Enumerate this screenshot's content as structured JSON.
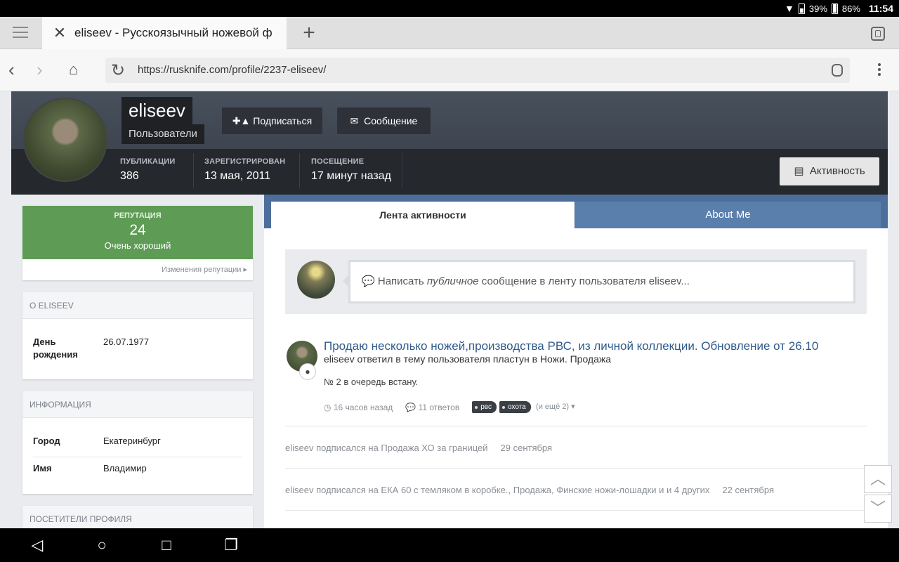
{
  "status_bar": {
    "battery1": "39%",
    "battery2": "86%",
    "time": "11:54"
  },
  "browser": {
    "tab_title": "eliseev - Русскоязычный ножевой ф",
    "url": "https://rusknife.com/profile/2237-eliseev/"
  },
  "profile": {
    "username": "eliseev",
    "group": "Пользователи",
    "follow_label": "Подписаться",
    "message_label": "Сообщение",
    "activity_label": "Активность",
    "stats": [
      {
        "label": "ПУБЛИКАЦИИ",
        "value": "386"
      },
      {
        "label": "ЗАРЕГИСТРИРОВАН",
        "value": "13 мая, 2011"
      },
      {
        "label": "ПОСЕЩЕНИЕ",
        "value": "17 минут назад"
      }
    ]
  },
  "sidebar": {
    "reputation": {
      "label": "РЕПУТАЦИЯ",
      "value": "24",
      "desc": "Очень хороший",
      "link": "Изменения репутации"
    },
    "about": {
      "title": "О ELISEEV",
      "rows": [
        {
          "key": "День рождения",
          "value": "26.07.1977"
        }
      ]
    },
    "info": {
      "title": "ИНФОРМАЦИЯ",
      "rows": [
        {
          "key": "Город",
          "value": "Екатеринбург"
        },
        {
          "key": "Имя",
          "value": "Владимир"
        }
      ]
    },
    "visitors": {
      "title": "ПОСЕТИТЕЛИ ПРОФИЛЯ"
    }
  },
  "main": {
    "tabs": [
      {
        "label": "Лента активности"
      },
      {
        "label": "About Me"
      }
    ],
    "composer": {
      "prefix": "Написать ",
      "em": "публичное",
      "suffix": " сообщение в ленту пользователя eliseev..."
    },
    "activity": {
      "title": "Продаю несколько ножей,производства РВС, из личной коллекции. Обновление от 26.10",
      "subtitle": "eliseev ответил в тему пользователя пластун в Ножи. Продажа",
      "snippet": "№ 2 в очередь встану.",
      "time": "16 часов назад",
      "replies": "11 ответов",
      "tags": [
        "рвс",
        "охота"
      ],
      "more": "(и ещё 2)"
    },
    "feed": [
      {
        "text": "eliseev подписался на Продажа ХО за границей",
        "date": "29 сентября"
      },
      {
        "text": "eliseev подписался на ЕКА 60 с темляком в коробке., Продажа, Финские ножи-лошадки и и 4 других",
        "date": "22 сентября"
      }
    ]
  }
}
